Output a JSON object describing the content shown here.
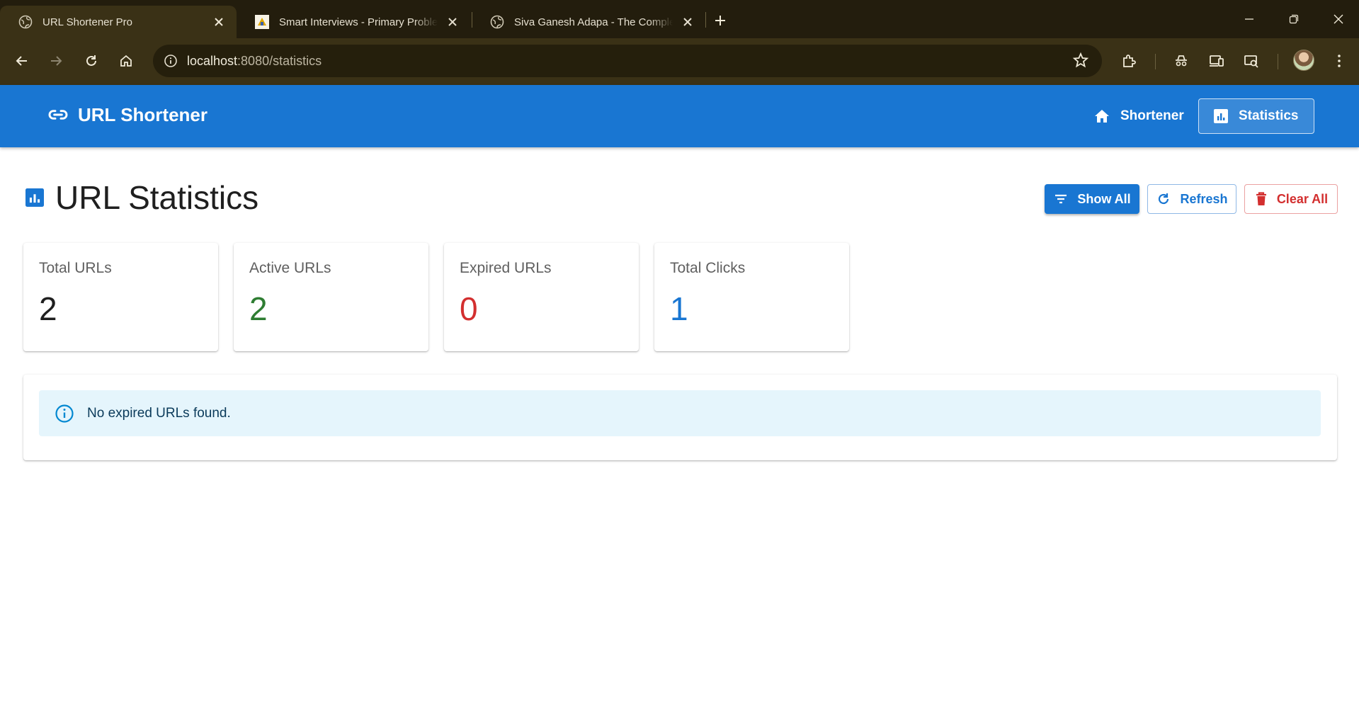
{
  "browser": {
    "tabs": [
      {
        "title": "URL Shortener Pro",
        "active": true,
        "favicon": "globe-icon"
      },
      {
        "title": "Smart Interviews - Primary Problem",
        "active": false,
        "favicon": "smart-interviews-logo"
      },
      {
        "title": "Siva Ganesh Adapa - The Complete",
        "active": false,
        "favicon": "globe-icon"
      }
    ],
    "address": {
      "host": "localhost",
      "path": ":8080/statistics"
    }
  },
  "app": {
    "brand": "URL Shortener",
    "nav": [
      {
        "label": "Shortener",
        "icon": "home-icon",
        "selected": false
      },
      {
        "label": "Statistics",
        "icon": "bar-chart-icon",
        "selected": true
      }
    ]
  },
  "page": {
    "title": "URL Statistics",
    "actions": {
      "show_all": "Show All",
      "refresh": "Refresh",
      "clear_all": "Clear All"
    },
    "stats": [
      {
        "label": "Total URLs",
        "value": "2",
        "color": "#1f1f1f"
      },
      {
        "label": "Active URLs",
        "value": "2",
        "color": "#2e7d32"
      },
      {
        "label": "Expired URLs",
        "value": "0",
        "color": "#d32f2f"
      },
      {
        "label": "Total Clicks",
        "value": "1",
        "color": "#1976d2"
      }
    ],
    "alert": {
      "message": "No expired URLs found.",
      "severity": "info"
    }
  },
  "colors": {
    "primary": "#1976d2",
    "error": "#d32f2f",
    "success": "#2e7d32",
    "info_bg": "#e5f5fc"
  }
}
